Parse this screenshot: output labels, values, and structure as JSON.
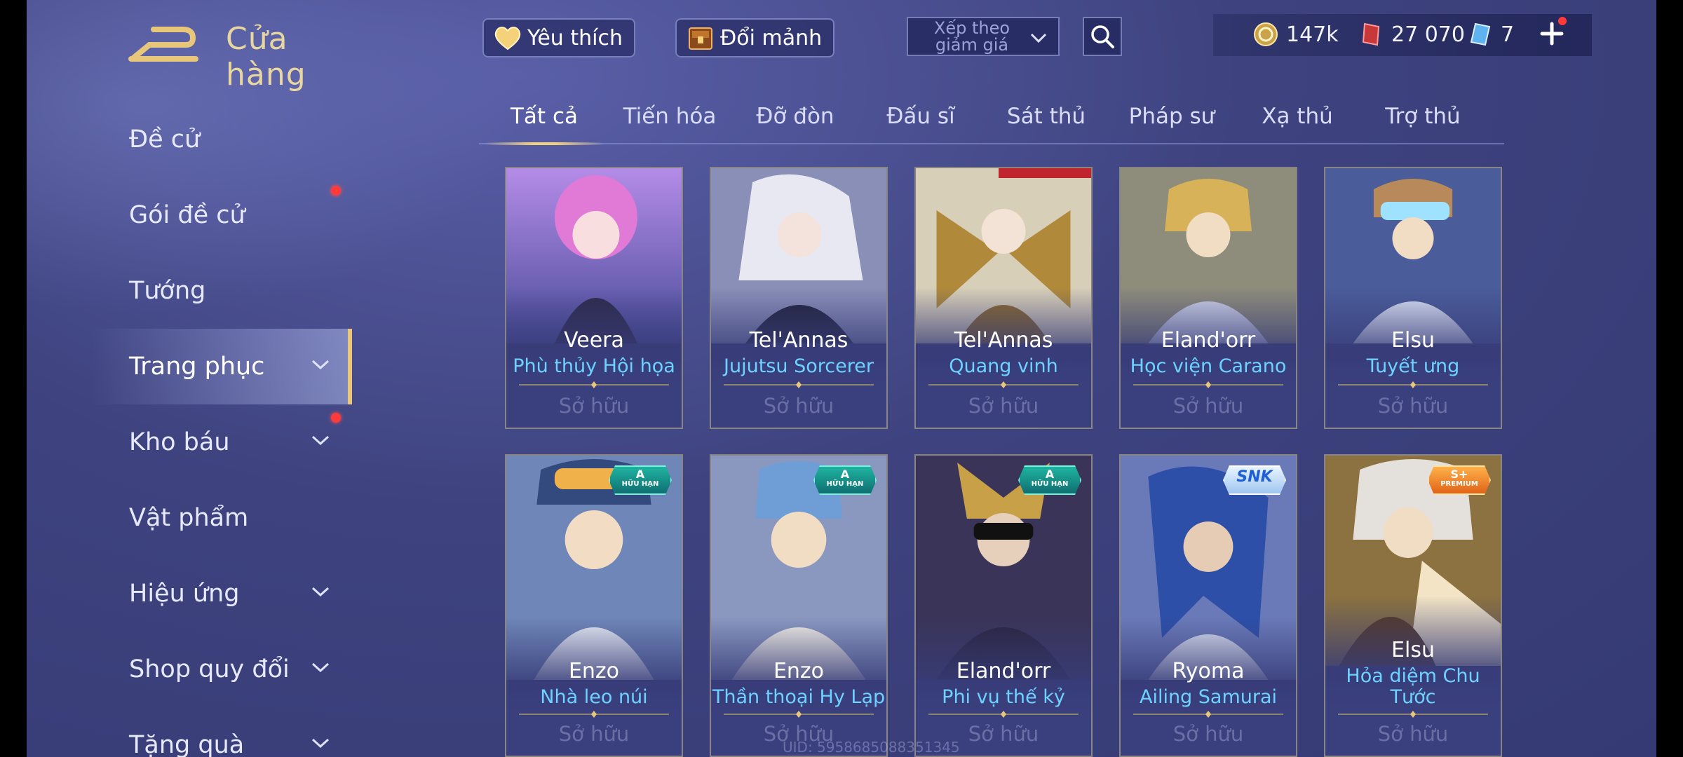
{
  "sidebar": {
    "title": "Cửa hàng",
    "items": [
      {
        "label": "Đề cử",
        "chevron": false,
        "dot": false,
        "active": false
      },
      {
        "label": "Gói đề cử",
        "chevron": false,
        "dot": true,
        "active": false
      },
      {
        "label": "Tướng",
        "chevron": false,
        "dot": false,
        "active": false
      },
      {
        "label": "Trang phục",
        "chevron": true,
        "dot": false,
        "active": true
      },
      {
        "label": "Kho báu",
        "chevron": true,
        "dot": true,
        "active": false
      },
      {
        "label": "Vật phẩm",
        "chevron": false,
        "dot": false,
        "active": false
      },
      {
        "label": "Hiệu ứng",
        "chevron": true,
        "dot": false,
        "active": false
      },
      {
        "label": "Shop quy đổi",
        "chevron": true,
        "dot": false,
        "active": false
      },
      {
        "label": "Tặng quà",
        "chevron": true,
        "dot": false,
        "active": false
      }
    ]
  },
  "topbar": {
    "favorite_label": "Yêu thích",
    "exchange_label": "Đổi mảnh",
    "sort_label": "Xếp theo giảm giá",
    "currencies": {
      "gold": "147k",
      "coupons": "27 070",
      "tickets": "7"
    }
  },
  "tabs": [
    "Tất cả",
    "Tiến hóa",
    "Đỡ đòn",
    "Đấu sĩ",
    "Sát thủ",
    "Pháp sư",
    "Xạ thủ",
    "Trợ thủ"
  ],
  "active_tab": "Tất cả",
  "cards_row1": [
    {
      "hero": "Veera",
      "skin": "Phù thủy Hội họa",
      "status": "Sở hữu",
      "art": "veera-art"
    },
    {
      "hero": "Tel'Annas",
      "skin": "Jujutsu Sorcerer",
      "status": "Sở hữu",
      "art": "telannas-art"
    },
    {
      "hero": "Tel'Annas",
      "skin": "Quang vinh",
      "status": "Sở hữu",
      "art": "telannas-art"
    },
    {
      "hero": "Eland'orr",
      "skin": "Học viện Carano",
      "status": "Sở hữu",
      "art": "elandorr-art"
    },
    {
      "hero": "Elsu",
      "skin": "Tuyết ưng",
      "status": "Sở hữu",
      "art": "elsu-art"
    }
  ],
  "cards_row2": [
    {
      "hero": "Enzo",
      "skin": "Nhà leo núi",
      "status": "Sở hữu",
      "badge": "A",
      "badge_sub": "HỮU HẠN",
      "art": "enzo-art"
    },
    {
      "hero": "Enzo",
      "skin": "Thần thoại Hy Lạp",
      "status": "Sở hữu",
      "badge": "A",
      "badge_sub": "HỮU HẠN",
      "art": "enzo-art"
    },
    {
      "hero": "Eland'orr",
      "skin": "Phi vụ thế kỷ",
      "status": "Sở hữu",
      "badge": "A",
      "badge_sub": "HỮU HẠN",
      "art": "elandorr-art"
    },
    {
      "hero": "Ryoma",
      "skin": "Ailing Samurai",
      "status": "Sở hữu",
      "badge": "SNK",
      "badge_sub": "",
      "art": "ryoma-art"
    },
    {
      "hero": "Elsu",
      "skin": "Hỏa diệm Chu Tước",
      "status": "Sở hữu",
      "badge": "S+",
      "badge_sub": "PREMIUM",
      "art": "elsu-art"
    }
  ],
  "uid_text": "UID: 5958685088351345",
  "colors": {
    "accent_gold": "#e8c77a",
    "skin_name": "#6ed2ff",
    "owned": "#6a70a6",
    "notify": "#ff3a3a"
  }
}
